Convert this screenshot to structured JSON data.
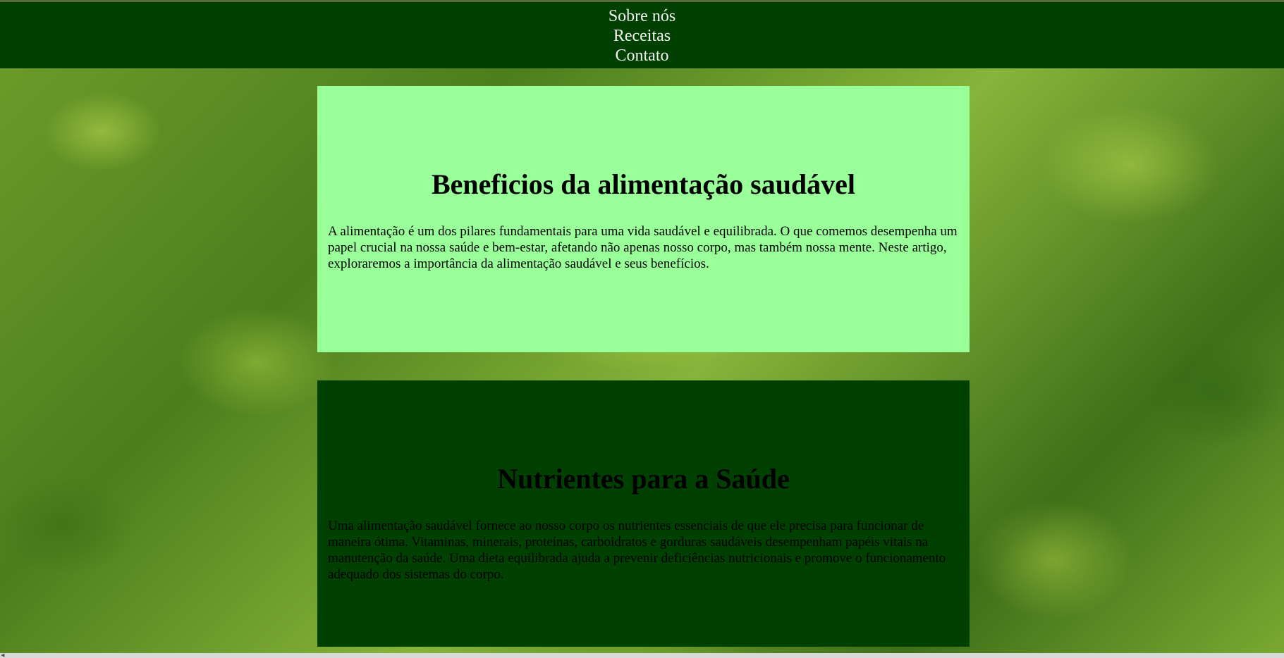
{
  "nav": {
    "items": [
      {
        "label": "Sobre nós"
      },
      {
        "label": "Receitas"
      },
      {
        "label": "Contato"
      }
    ]
  },
  "sections": [
    {
      "title": "Beneficios da alimentação saudável",
      "text": "A alimentação é um dos pilares fundamentais para uma vida saudável e equilibrada. O que comemos desempenha um papel crucial na nossa saúde e bem-estar, afetando não apenas nosso corpo, mas também nossa mente. Neste artigo, exploraremos a importância da alimentação saudável e seus benefícios."
    },
    {
      "title": "Nutrientes para a Saúde",
      "text": "Uma alimentação saudável fornece ao nosso corpo os nutrientes essenciais de que ele precisa para funcionar de maneira ótima. Vitaminas, minerais, proteínas, carboidratos e gorduras saudáveis desempenham papéis vitais na manutenção da saúde. Uma dieta equilibrada ajuda a prevenir deficiências nutricionais e promove o funcionamento adequado dos sistemas do corpo."
    }
  ],
  "colors": {
    "nav_background": "#004000",
    "nav_text": "#f2f2f2",
    "card_light": "#99ff99",
    "card_dark": "#004000",
    "background_image": "lettuce-leaves"
  }
}
